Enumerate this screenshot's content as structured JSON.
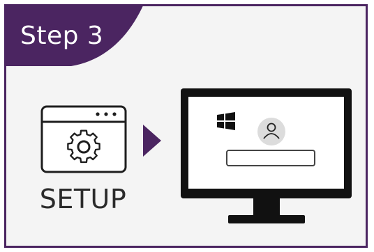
{
  "step_label": "Step 3",
  "setup_label": "SETUP",
  "colors": {
    "accent": "#4b2561",
    "panel_background": "#f4f4f4",
    "monitor_frame": "#111111",
    "screen": "#ffffff",
    "avatar": "#dcdcdc"
  },
  "icons": {
    "settings": "gear-icon",
    "direction": "arrow-right-icon",
    "os_logo": "windows-logo-icon",
    "user": "user-avatar-icon"
  }
}
